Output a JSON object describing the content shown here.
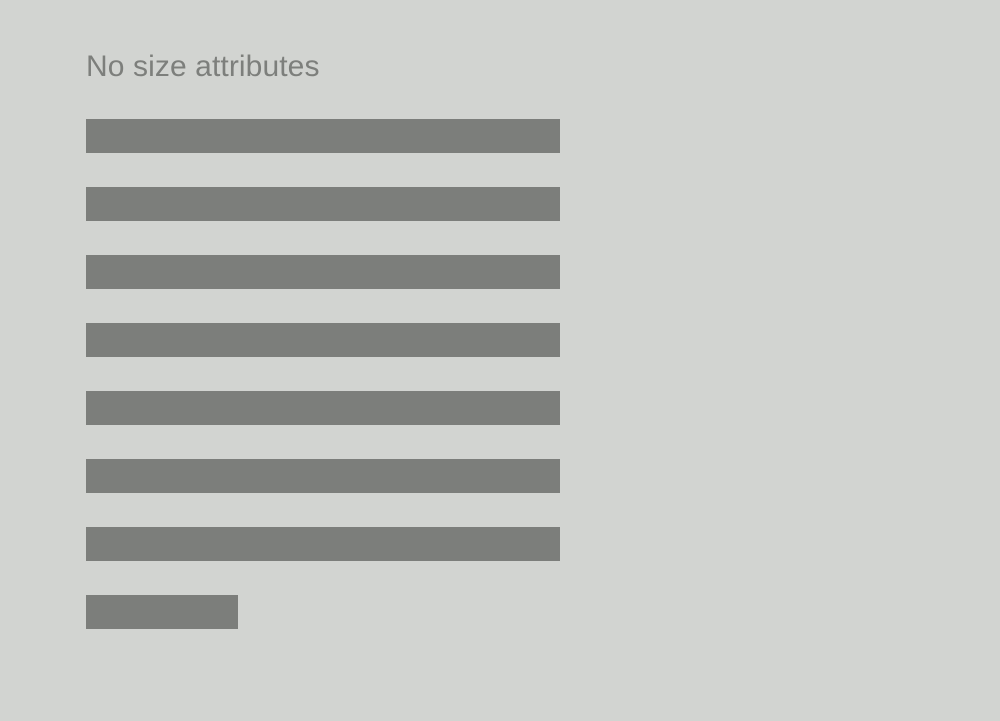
{
  "page": {
    "title": "No size attributes"
  },
  "content": {
    "lines": [
      {
        "kind": "full"
      },
      {
        "kind": "full"
      },
      {
        "kind": "full"
      },
      {
        "kind": "full"
      },
      {
        "kind": "full"
      },
      {
        "kind": "full"
      },
      {
        "kind": "full"
      },
      {
        "kind": "short"
      }
    ]
  },
  "colors": {
    "background": "#d2d4d1",
    "title": "#7d7f7c",
    "placeholder": "#7c7e7b"
  }
}
